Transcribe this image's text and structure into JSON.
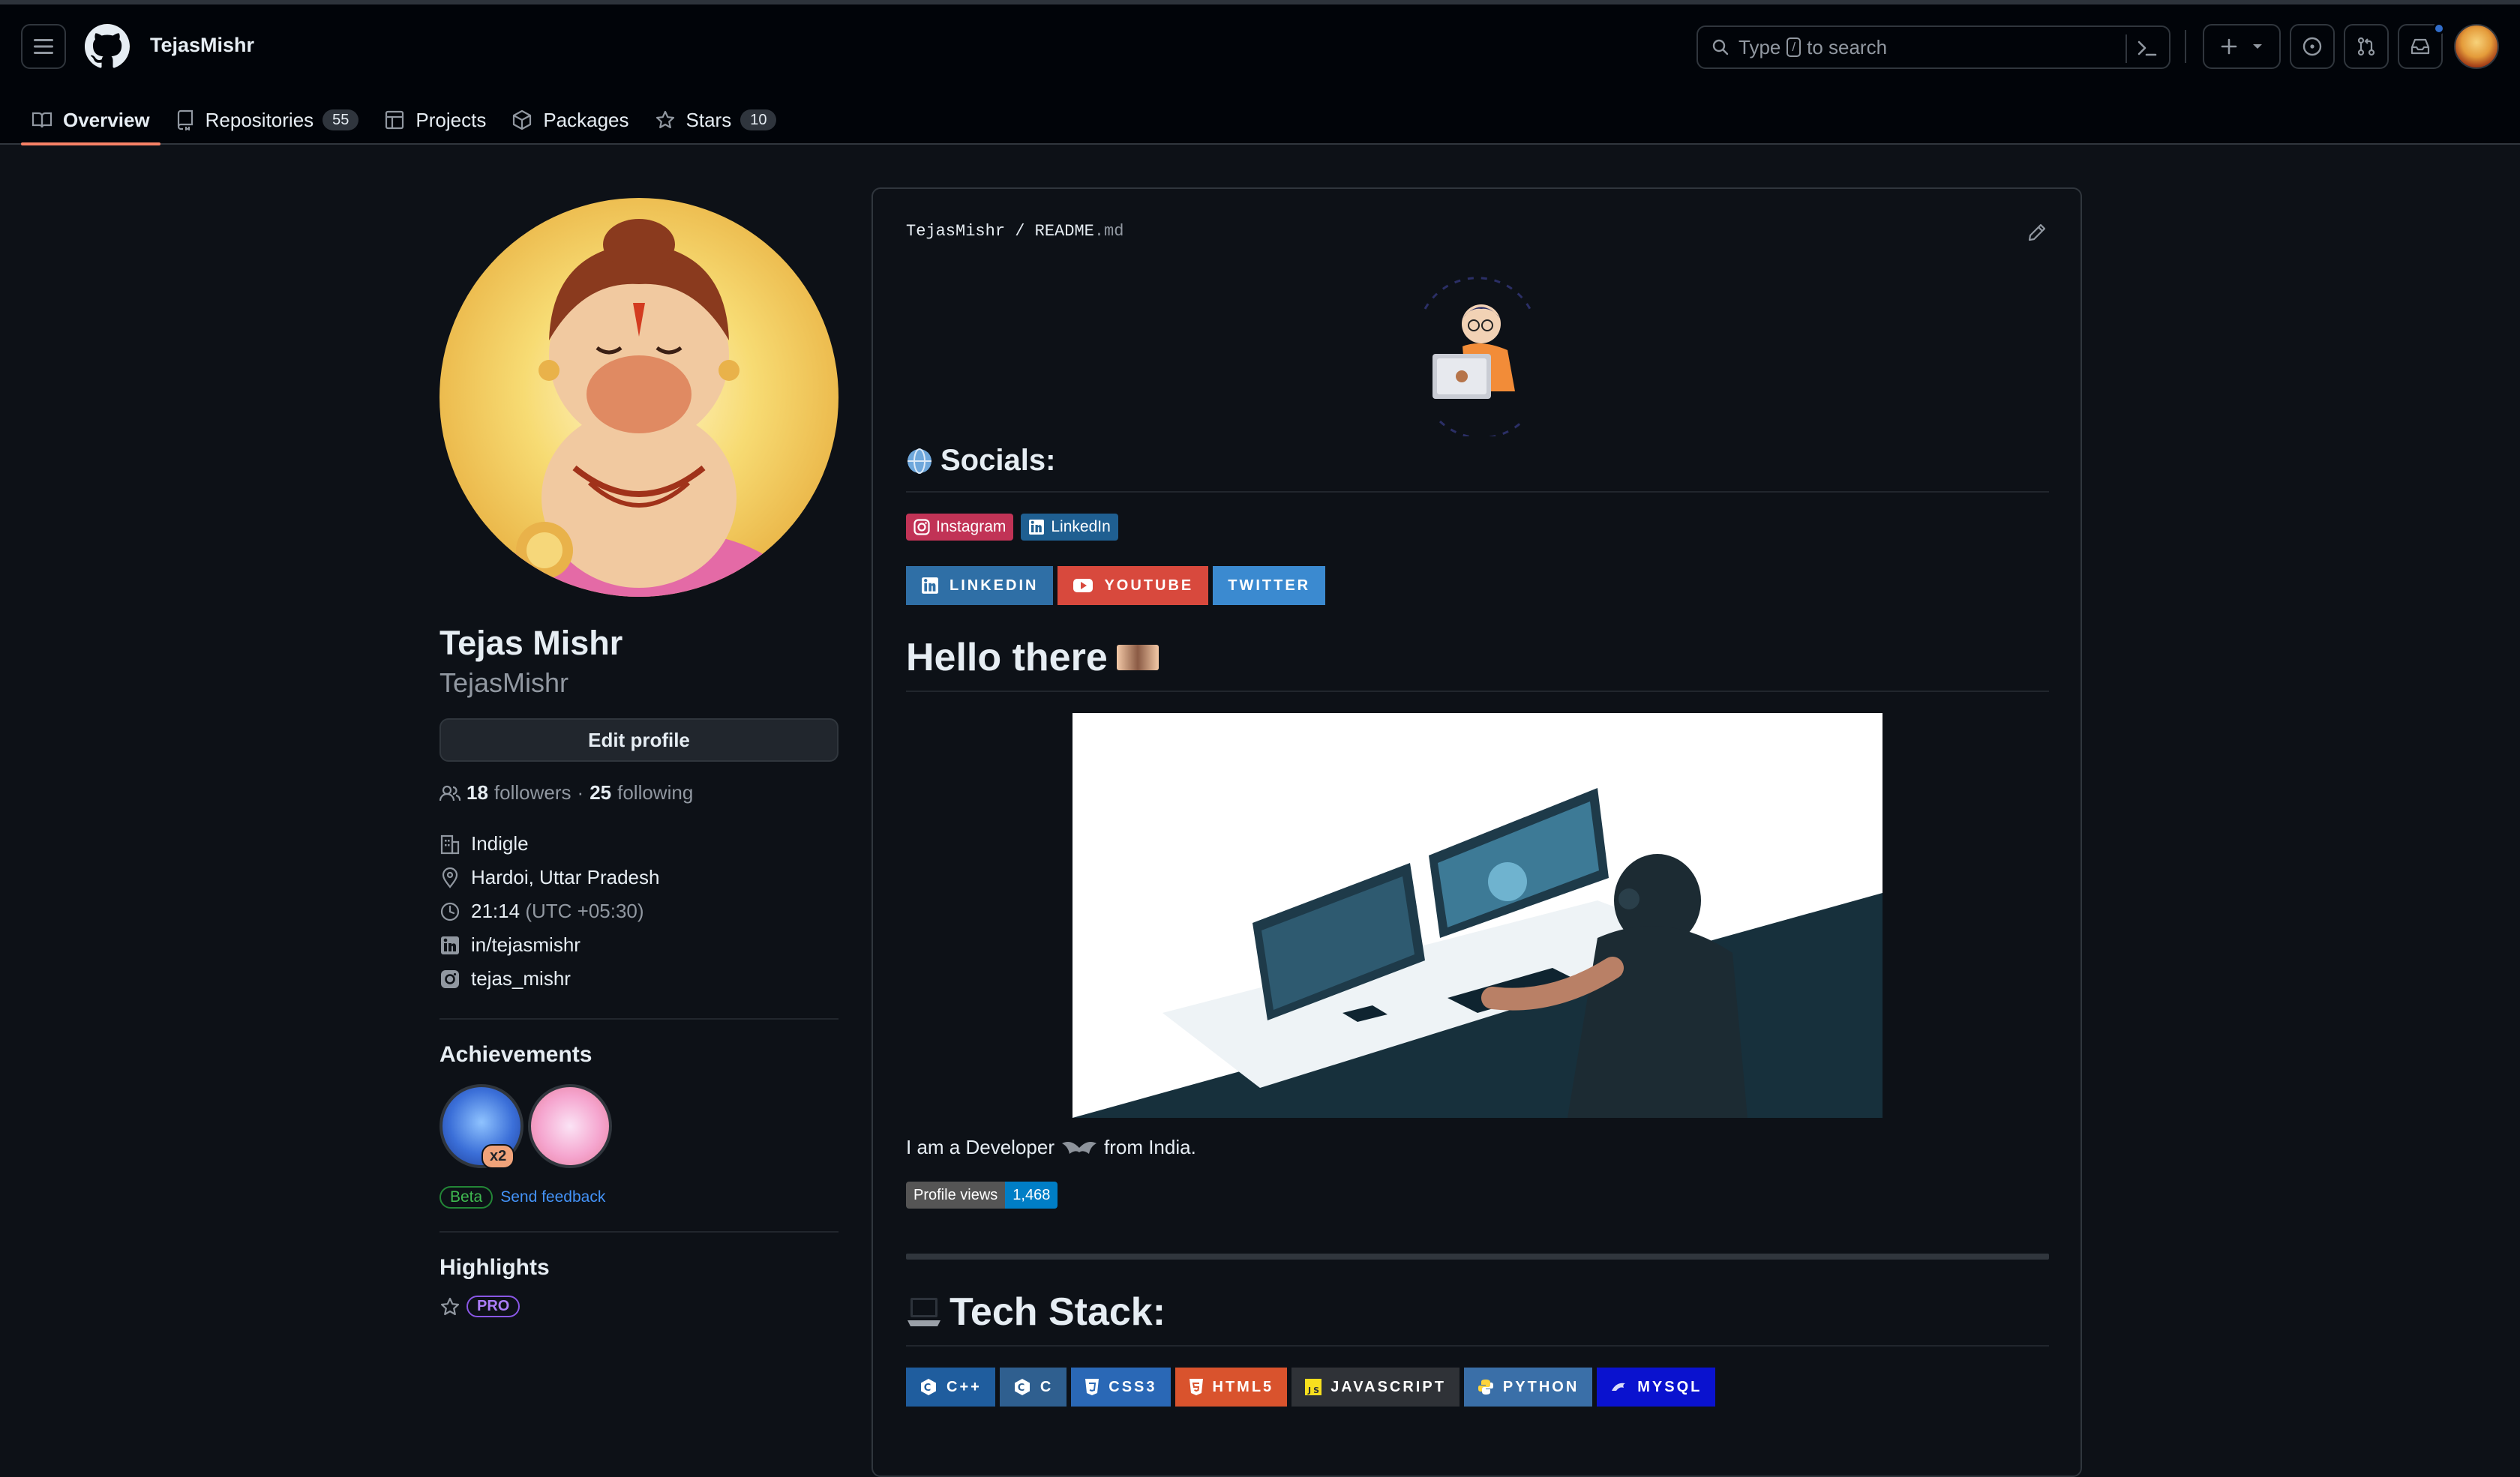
{
  "header": {
    "username": "TejasMishr",
    "search": {
      "prefix": "Type",
      "key": "/",
      "suffix": "to search"
    }
  },
  "tabs": [
    {
      "label": "Overview",
      "icon": "book-icon",
      "active": true
    },
    {
      "label": "Repositories",
      "icon": "repo-icon",
      "count": "55"
    },
    {
      "label": "Projects",
      "icon": "table-icon"
    },
    {
      "label": "Packages",
      "icon": "package-icon"
    },
    {
      "label": "Stars",
      "icon": "star-icon",
      "count": "10"
    }
  ],
  "profile": {
    "name": "Tejas Mishr",
    "login": "TejasMishr",
    "edit_label": "Edit profile",
    "followers_count": "18",
    "followers_label": "followers",
    "sep": "·",
    "following_count": "25",
    "following_label": "following",
    "company": "Indigle",
    "location": "Hardoi, Uttar Pradesh",
    "local_time": "21:14",
    "timezone": "(UTC +05:30)",
    "linkedin": "in/tejasmishr",
    "instagram": "tejas_mishr",
    "status_emoji": "🎯"
  },
  "achievements": {
    "title": "Achievements",
    "multiplier": "x2",
    "beta": "Beta",
    "feedback": "Send feedback"
  },
  "highlights": {
    "title": "Highlights",
    "pro": "PRO"
  },
  "readme": {
    "owner": "TejasMishr",
    "slash": "/",
    "file": "README",
    "ext": ".md",
    "socials_title": "Socials:",
    "small_badges": [
      "Instagram",
      "LinkedIn"
    ],
    "big_badges": [
      "LINKEDIN",
      "YOUTUBE",
      "TWITTER"
    ],
    "hello_title": "Hello there",
    "dev_text_before": "I am a Developer",
    "dev_text_after": "from India.",
    "profile_views_label": "Profile views",
    "profile_views_count": "1,468",
    "tech_title": "Tech Stack:",
    "tech_badges": [
      "C++",
      "C",
      "CSS3",
      "HTML5",
      "JAVASCRIPT",
      "PYTHON",
      "MYSQL"
    ]
  },
  "colors": {
    "accent_tab": "#f78166",
    "instagram": "#E4405F",
    "linkedin": "#0077B5",
    "youtube": "#FF0000",
    "twitter": "#1DA1F2"
  }
}
